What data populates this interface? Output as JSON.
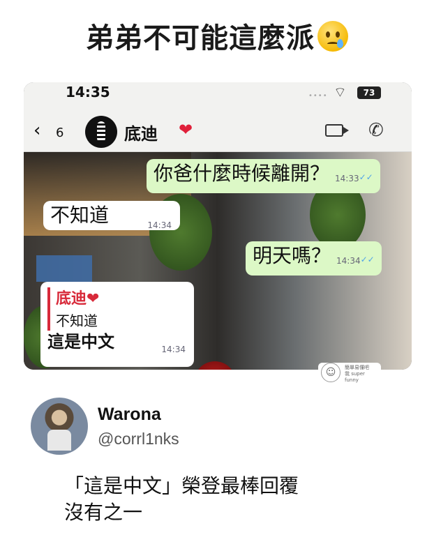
{
  "headline": "弟弟不可能這麼派",
  "emoji": "face-holding-back-tears-emoji",
  "statusbar": {
    "time": "14:35",
    "battery": "73"
  },
  "chat_header": {
    "back_count": "6",
    "contact_name": "底迪",
    "heart": "❤"
  },
  "messages": [
    {
      "direction": "out",
      "text": "你爸什麼時候離開？",
      "time": "14:33",
      "ticks": "✓✓"
    },
    {
      "direction": "in",
      "text": "不知道",
      "time": "14:34"
    },
    {
      "direction": "out",
      "text": "明天嗎？",
      "time": "14:34",
      "ticks": "✓✓"
    },
    {
      "direction": "in",
      "quote_name": "底迪",
      "quote_heart": "❤",
      "quote_text": "不知道",
      "text": "這是中文",
      "time": "14:34"
    }
  ],
  "watermark": {
    "line1": "簡單易懂吧",
    "line2": "我 super funny"
  },
  "tweet": {
    "name": "Warona",
    "handle": "@corrl1nks",
    "line1": "「這是中文」榮登最棒回覆",
    "line2": "沒有之一"
  },
  "colors": {
    "outgoing_bubble": "#dcf8c6",
    "incoming_bubble": "#ffffff",
    "quote_accent": "#d82a3a",
    "read_ticks": "#4fa3e8"
  }
}
